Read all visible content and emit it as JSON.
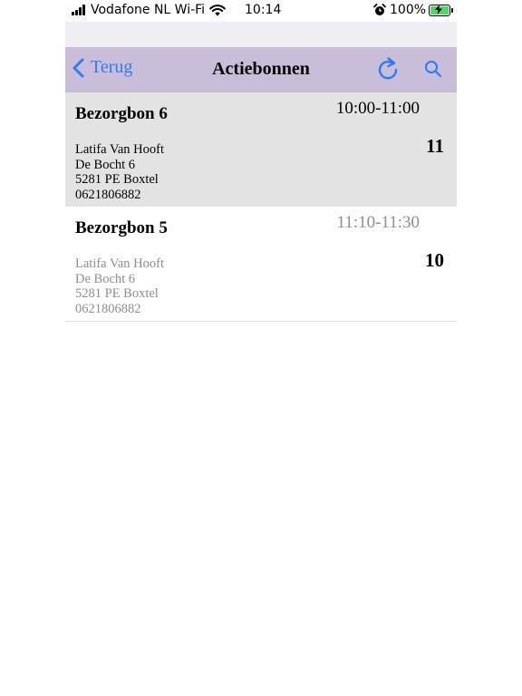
{
  "status_bar": {
    "carrier": "Vodafone NL Wi-Fi",
    "time": "10:14",
    "battery": "100%"
  },
  "navbar": {
    "back_label": "Terug",
    "title": "Actiebonnen",
    "accent_color": "#2d7cf6",
    "background_color": "#c8bed9"
  },
  "orders": [
    {
      "title": "Bezorgbon 6",
      "time_slot": "10:00-11:00",
      "number": "11",
      "lines": [
        "Latifa Van Hooft",
        "De Bocht 6",
        "5281 PE Boxtel",
        "0621806882"
      ]
    },
    {
      "title": "Bezorgbon 5",
      "time_slot": "11:10-11:30",
      "number": "10",
      "lines": [
        "Latifa Van Hooft",
        "De Bocht 6",
        "5281 PE Boxtel",
        "0621806882"
      ]
    }
  ]
}
